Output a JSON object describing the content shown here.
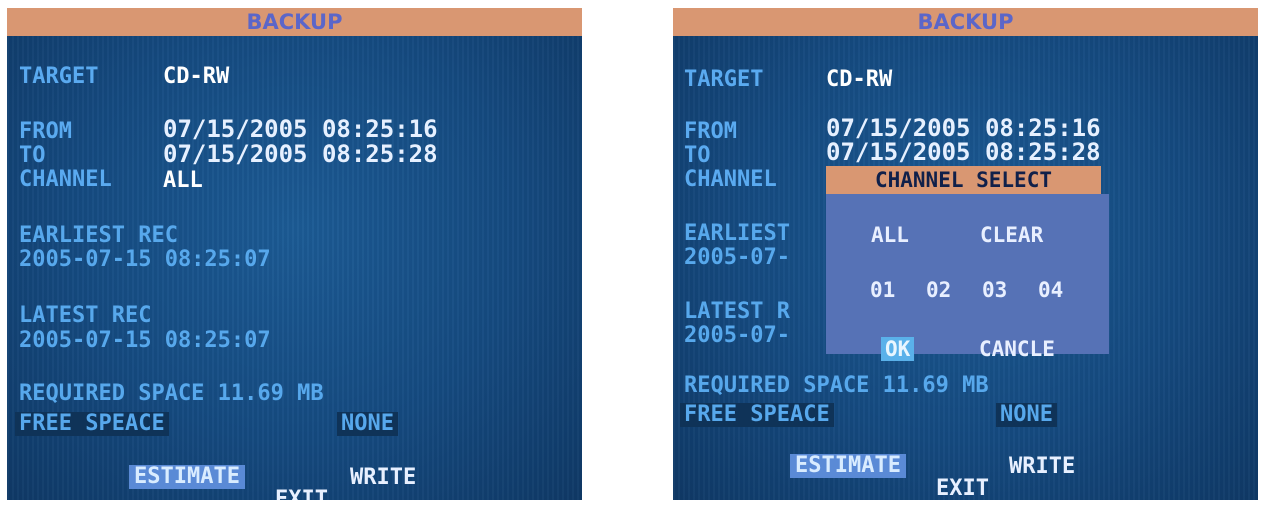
{
  "left": {
    "title": "BACKUP",
    "target_label": "TARGET",
    "target_value": "CD-RW",
    "from_label": "FROM",
    "from_value": "07/15/2005 08:25:16",
    "to_label": "TO",
    "to_value": "07/15/2005 08:25:28",
    "channel_label": "CHANNEL",
    "channel_value": "ALL",
    "earliest_label": "EARLIEST REC",
    "earliest_value": "2005-07-15 08:25:07",
    "latest_label": "LATEST REC",
    "latest_value": "2005-07-15 08:25:07",
    "required_space": "REQUIRED SPACE 11.69 MB",
    "free_label": "FREE SPEACE",
    "free_value": "NONE",
    "estimate": "ESTIMATE",
    "write": "WRITE",
    "exit": "EXIT"
  },
  "right": {
    "title": "BACKUP",
    "target_label": "TARGET",
    "target_value": "CD-RW",
    "from_label": "FROM",
    "from_value": "07/15/2005 08:25:16",
    "to_label": "TO",
    "to_value": "07/15/2005 08:25:28",
    "channel_label": "CHANNEL",
    "earliest_partial": "EARLIEST",
    "earliest_value_partial": "2005-07-",
    "latest_partial": "LATEST R",
    "latest_value_partial": "2005-07-",
    "required_space": "REQUIRED SPACE 11.69 MB",
    "free_label": "FREE SPEACE",
    "free_value": "NONE",
    "estimate": "ESTIMATE",
    "write": "WRITE",
    "exit": "EXIT",
    "channel_select": {
      "title": "CHANNEL SELECT",
      "all": "ALL",
      "clear": "CLEAR",
      "channels": [
        "01",
        "02",
        "03",
        "04"
      ],
      "ok": "OK",
      "cancel": "CANCLE"
    }
  },
  "colors": {
    "title_bar": "#d99772",
    "screen_blue": "#154a80",
    "label_blue": "#5aaaf0",
    "highlight": "#5a8ad6",
    "modal": "#5672b6"
  }
}
